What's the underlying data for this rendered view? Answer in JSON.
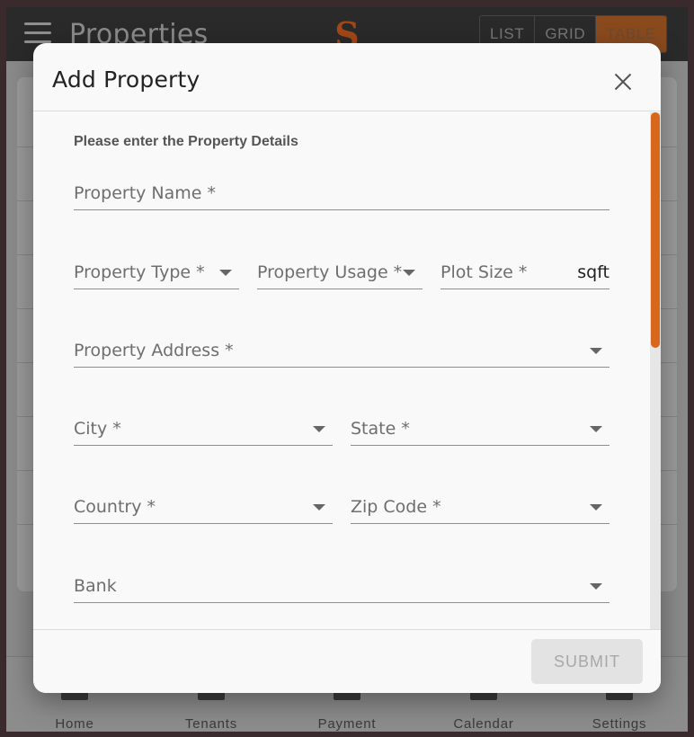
{
  "app": {
    "title": "Properties",
    "logo_text": "S",
    "view_modes": [
      "LIST",
      "GRID",
      "TABLE"
    ],
    "active_view": "TABLE"
  },
  "bottom_nav": [
    "Home",
    "Tenants",
    "Payment",
    "Calendar",
    "Settings"
  ],
  "dialog": {
    "title": "Add Property",
    "section_label": "Please enter the Property Details",
    "fields": {
      "property_name": "Property Name *",
      "property_type": "Property Type *",
      "property_usage": "Property Usage *",
      "plot_size": "Plot Size *",
      "plot_size_unit": "sqft",
      "property_address": "Property Address *",
      "city": "City *",
      "state": "State *",
      "country": "Country *",
      "zip_code": "Zip Code *",
      "bank": "Bank"
    },
    "submit_label": "SUBMIT"
  },
  "colors": {
    "accent": "#d7671a",
    "dialog_bg": "#f9f9f9"
  }
}
